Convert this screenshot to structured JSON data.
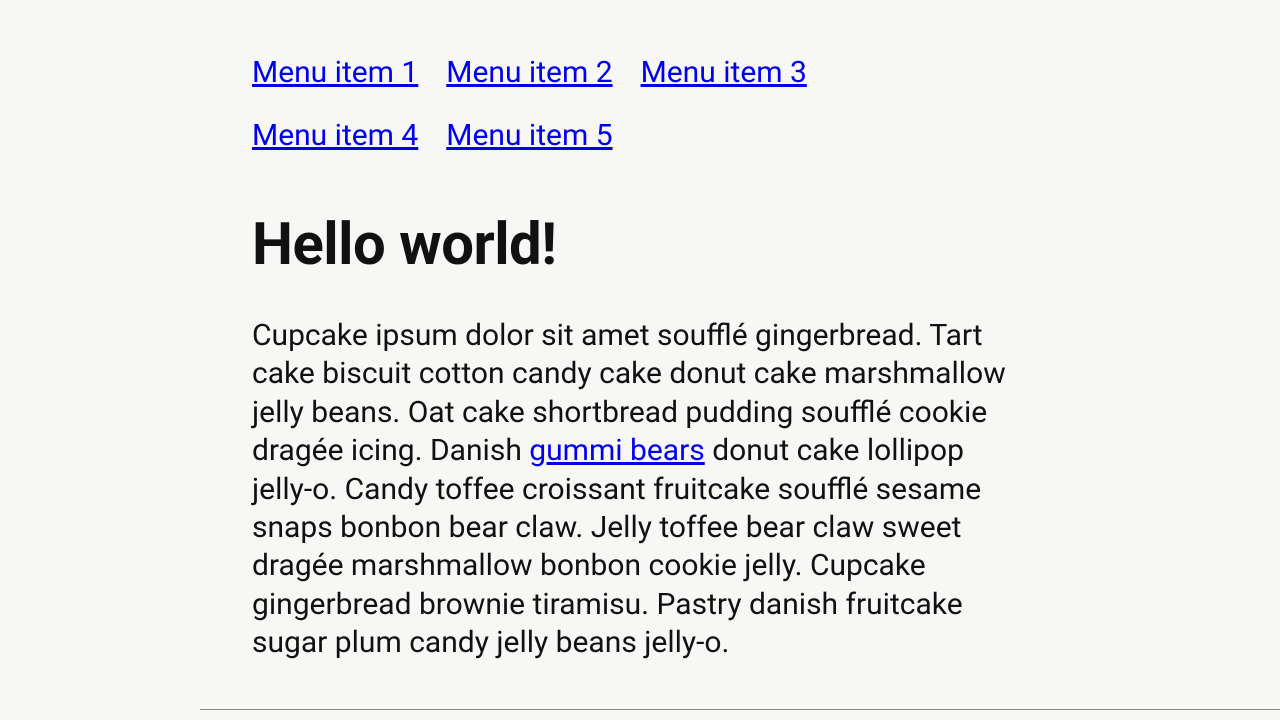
{
  "nav": {
    "items": [
      {
        "label": "Menu item 1"
      },
      {
        "label": "Menu item 2"
      },
      {
        "label": "Menu item 3"
      },
      {
        "label": "Menu item 4"
      },
      {
        "label": "Menu item 5"
      }
    ]
  },
  "heading": "Hello world!",
  "paragraph": {
    "before": "Cupcake ipsum dolor sit amet soufflé gingerbread. Tart cake biscuit cotton candy cake donut cake marshmallow jelly beans. Oat cake shortbread pudding soufflé cookie dragée icing. Danish ",
    "link_text": "gummi bears",
    "after": " donut cake lollipop jelly-o. Candy toffee croissant fruitcake soufflé sesame snaps bonbon bear claw. Jelly toffee bear claw sweet dragée marshmallow bonbon cookie jelly. Cupcake gingerbread brownie tiramisu. Pastry danish fruitcake sugar plum candy jelly beans jelly-o."
  }
}
